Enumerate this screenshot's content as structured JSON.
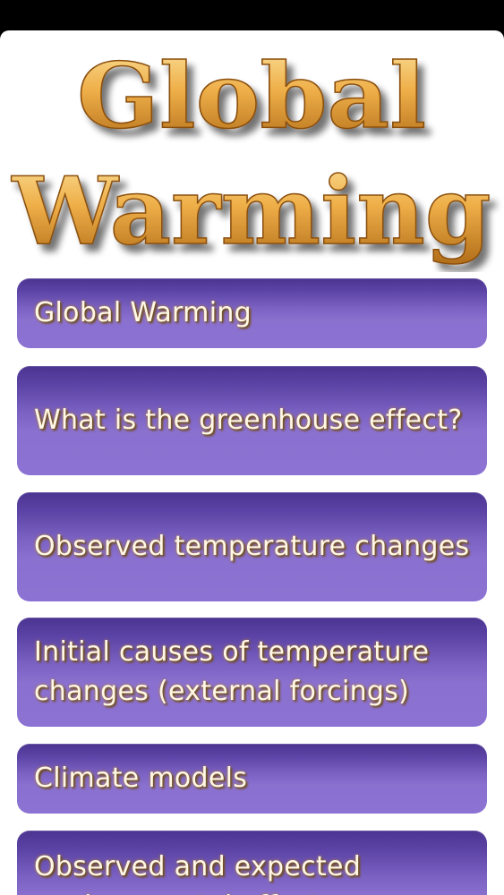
{
  "banner": {
    "title_line1": "Global",
    "title_line2": "Warming",
    "colors": {
      "gold_light": "#fbe19a",
      "gold_mid": "#e9a43a",
      "gold_dark": "#9a5a12"
    }
  },
  "menu": {
    "items": [
      {
        "label": "Global Warming"
      },
      {
        "label": "What is the greenhouse effect?"
      },
      {
        "label": "Observed temperature changes"
      },
      {
        "label": "Initial causes of temperature changes (external forcings)"
      },
      {
        "label": "Climate models"
      },
      {
        "label": "Observed and expected environmental effects"
      }
    ],
    "colors": {
      "button_top": "#4a3490",
      "button_bottom": "#8c72d2",
      "text": "#fff8e6"
    }
  }
}
